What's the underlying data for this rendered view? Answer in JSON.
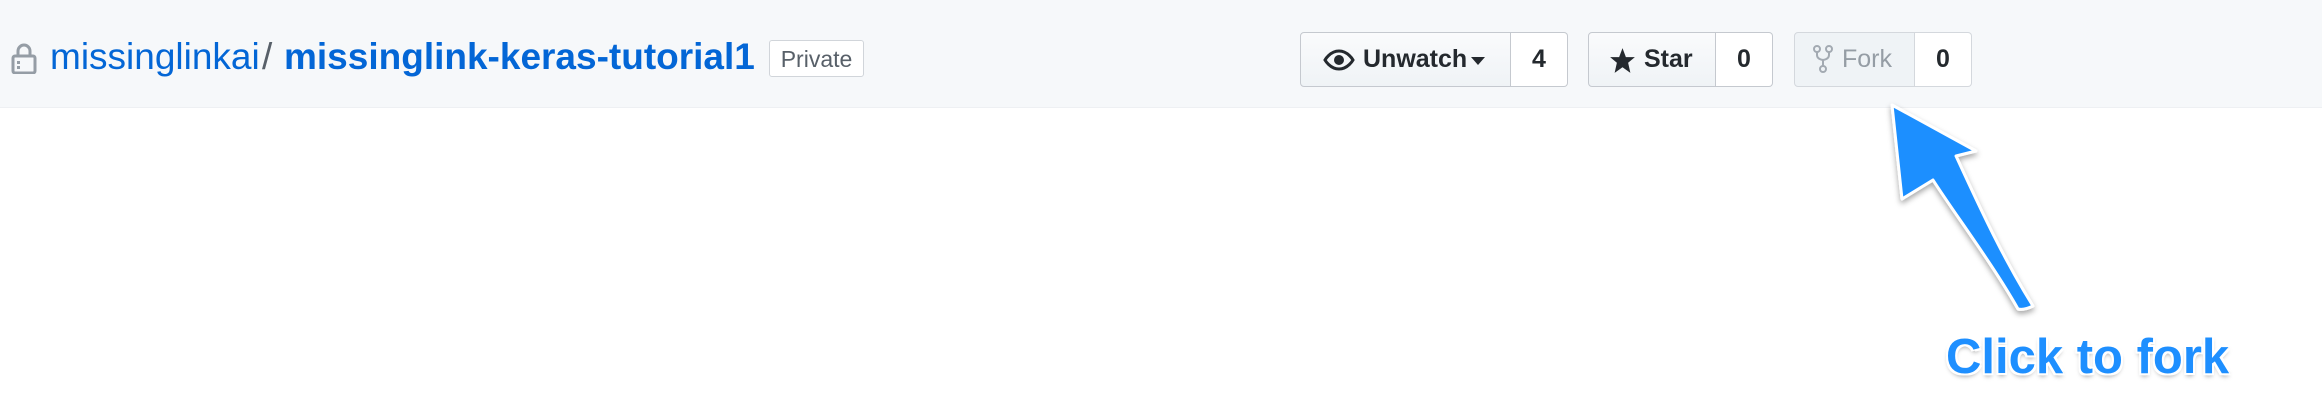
{
  "repo": {
    "owner": "missinglinkai",
    "separator": "/",
    "name": "missinglink-keras-tutorial1",
    "visibility_label": "Private"
  },
  "actions": {
    "watch": {
      "label": "Unwatch",
      "count": "4",
      "icon": "eye-icon"
    },
    "star": {
      "label": "Star",
      "count": "0",
      "icon": "star-icon"
    },
    "fork": {
      "label": "Fork",
      "count": "0",
      "icon": "repo-forked-icon",
      "disabled": true
    }
  },
  "annotation": {
    "text": "Click to fork",
    "color": "#1e8fff"
  },
  "colors": {
    "link": "#0366d6",
    "header_bg": "#f6f8fa"
  }
}
